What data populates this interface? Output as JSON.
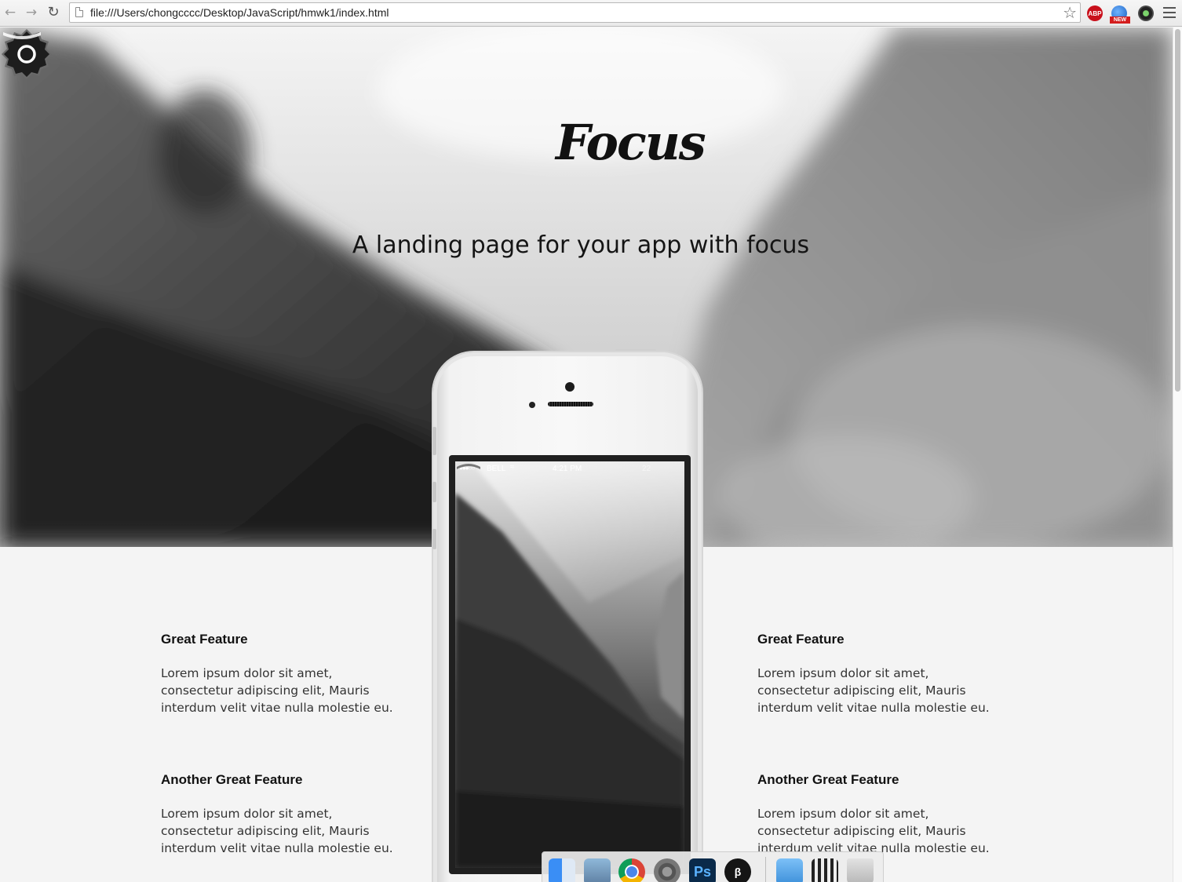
{
  "browser": {
    "url": "file:///Users/chongcccc/Desktop/JavaScript/hmwk1/index.html",
    "extensions": [
      "adblock-plus-icon",
      "new-extension-icon",
      "camera-extension-icon"
    ],
    "abp_label": "ABP",
    "new_label": "NEW"
  },
  "hero": {
    "brand": "Focus",
    "tagline": "A landing page for your app with focus"
  },
  "phone": {
    "carrier": "BELL",
    "time": "4:21 PM",
    "battery": "22"
  },
  "features": {
    "left": [
      {
        "title": "Great Feature",
        "text": "Lorem ipsum dolor sit amet, consectetur adipiscing elit, Mauris interdum velit vitae nulla molestie eu."
      },
      {
        "title": "Another Great Feature",
        "text": "Lorem ipsum dolor sit amet, consectetur adipiscing elit, Mauris interdum velit vitae nulla molestie eu."
      }
    ],
    "right": [
      {
        "title": "Great Feature",
        "text": "Lorem ipsum dolor sit amet, consectetur adipiscing elit, Mauris interdum velit vitae nulla molestie eu."
      },
      {
        "title": "Another Great Feature",
        "text": "Lorem ipsum dolor sit amet, consectetur adipiscing elit, Mauris interdum velit vitae nulla molestie eu."
      }
    ]
  },
  "dock": {
    "items": [
      "finder-icon",
      "preview-icon",
      "chrome-icon",
      "system-preferences-icon",
      "photoshop-icon",
      "terminal-icon",
      "folder-icon",
      "documents-stack-icon",
      "trash-icon"
    ],
    "photoshop_label": "Ps"
  },
  "colors": {
    "hero_text": "#141414",
    "section_background": "#f4f4f4"
  }
}
